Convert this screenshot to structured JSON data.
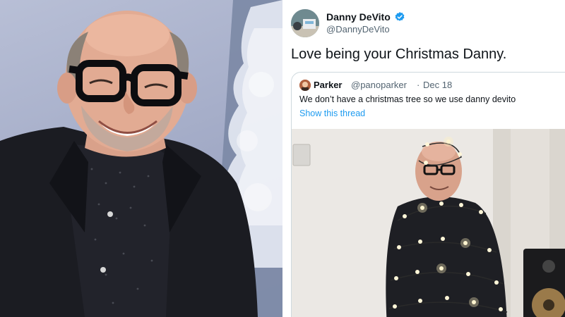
{
  "tweet": {
    "author_name": "Danny DeVito",
    "author_handle": "@DannyDeVito",
    "text": "Love being your Christmas Danny.",
    "verified_icon": "verified-badge-icon",
    "accent_color": "#1d9bf0"
  },
  "quoted_tweet": {
    "author_name": "Parker",
    "author_handle": "@panoparker",
    "separator": "·",
    "date": "Dec 18",
    "text": "We don’t have a christmas tree so we use danny devito",
    "thread_link": "Show this thread"
  }
}
